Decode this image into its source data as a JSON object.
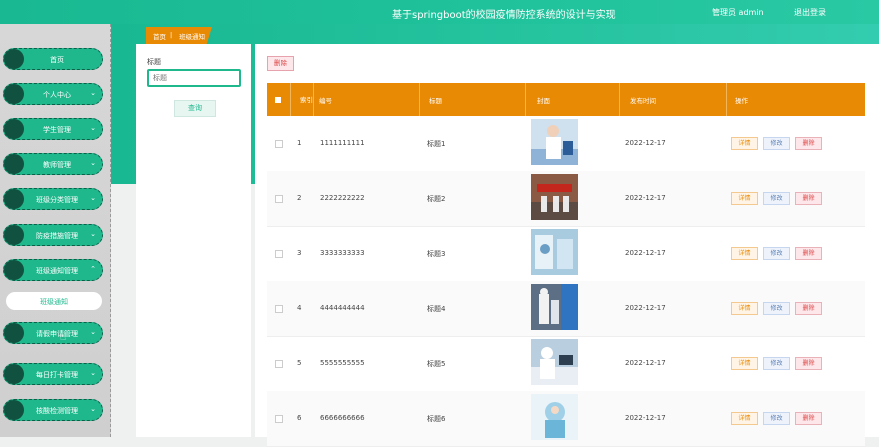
{
  "header": {
    "title": "基于springboot的校园疫情防控系统的设计与实现",
    "user": "管理员 admin",
    "logout": "退出登录"
  },
  "sidebar": {
    "items": [
      {
        "label": "首页",
        "has_chevron": false
      },
      {
        "label": "个人中心",
        "has_chevron": true
      },
      {
        "label": "学生管理",
        "has_chevron": true
      },
      {
        "label": "教师管理",
        "has_chevron": true
      },
      {
        "label": "班级分类管理",
        "has_chevron": true
      },
      {
        "label": "防疫措施管理",
        "has_chevron": true
      },
      {
        "label": "班级通知管理",
        "has_chevron": true
      },
      {
        "label": "班级通知",
        "submenu": true
      },
      {
        "label": "请假申请管理",
        "has_chevron": true
      },
      {
        "label": "每日打卡管理",
        "has_chevron": true
      },
      {
        "label": "核酸检测管理",
        "has_chevron": true
      }
    ]
  },
  "breadcrumb": {
    "home": "首页",
    "sep": "|",
    "current": "班级通知"
  },
  "search": {
    "label": "标题",
    "placeholder": "标题",
    "button": "查询"
  },
  "toolbar": {
    "delete_label": "删除"
  },
  "table": {
    "columns": [
      "",
      "索引",
      "编号",
      "标题",
      "封面",
      "发布时间",
      "操作"
    ],
    "rows": [
      {
        "index": "1",
        "code": "1111111111",
        "title": "标题1",
        "date": "2022-12-17"
      },
      {
        "index": "2",
        "code": "2222222222",
        "title": "标题2",
        "date": "2022-12-17"
      },
      {
        "index": "3",
        "code": "3333333333",
        "title": "标题3",
        "date": "2022-12-17"
      },
      {
        "index": "4",
        "code": "4444444444",
        "title": "标题4",
        "date": "2022-12-17"
      },
      {
        "index": "5",
        "code": "5555555555",
        "title": "标题5",
        "date": "2022-12-17"
      },
      {
        "index": "6",
        "code": "6666666666",
        "title": "标题6",
        "date": "2022-12-17"
      }
    ],
    "actions": {
      "detail": "详情",
      "edit": "修改",
      "delete": "删除"
    }
  },
  "colors": {
    "accent": "#1fb88d",
    "orange": "#e98a05"
  }
}
